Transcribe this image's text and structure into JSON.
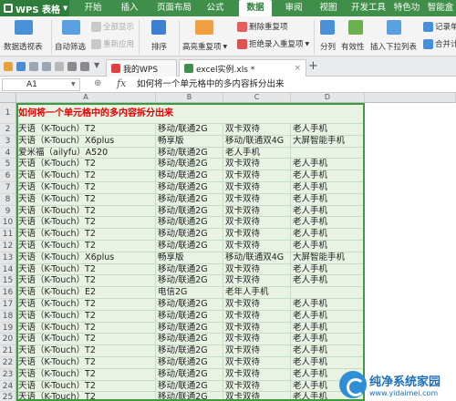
{
  "app": {
    "title": "WPS 表格"
  },
  "menu": {
    "items": [
      {
        "label": "开始",
        "active": false
      },
      {
        "label": "插入",
        "active": false
      },
      {
        "label": "页面布局",
        "active": false
      },
      {
        "label": "公式",
        "active": false
      },
      {
        "label": "数据",
        "active": true
      },
      {
        "label": "审阅",
        "active": false
      },
      {
        "label": "视图",
        "active": false
      },
      {
        "label": "开发工具",
        "active": false
      },
      {
        "label": "特色功能",
        "active": false
      },
      {
        "label": "智能盒子",
        "active": false
      }
    ]
  },
  "ribbon": {
    "pivot_label": "数据透视表",
    "autofilter_label": "自动筛选",
    "show_all_label": "全部显示",
    "reapply_label": "重新应用",
    "sort_label": "排序",
    "highlight_dup_label": "高亮重复项",
    "remove_dup_label": "删除重复项",
    "reject_dup_label": "拒绝录入重复项",
    "split_label": "分列",
    "validity_label": "有效性",
    "dropdown_label": "插入下拉列表",
    "record_label": "记录单",
    "merge_calc_label": "合并计算"
  },
  "tabs": [
    {
      "label": "我的WPS"
    },
    {
      "label": "excel实例.xls *"
    }
  ],
  "formula_bar": {
    "cell_ref": "A1",
    "fx": "fx",
    "content": "如何将一个单元格中的多内容拆分出来"
  },
  "columns": [
    "A",
    "B",
    "C",
    "D"
  ],
  "rows": [
    {
      "n": "1",
      "a": "如何将一个单元格中的多内容拆分出来",
      "b": "",
      "c": "",
      "d": ""
    },
    {
      "n": "2",
      "a": "天语（K-Touch）T2",
      "b": "移动/联通2G",
      "c": "双卡双待",
      "d": "老人手机"
    },
    {
      "n": "3",
      "a": "天语（K-Touch）X6plus",
      "b": "畅享版",
      "c": "移动/联通双4G",
      "d": "大屏智能手机"
    },
    {
      "n": "4",
      "a": "爱米福（ailyfu）A520",
      "b": "移动/联通2G",
      "c": "老人手机",
      "d": ""
    },
    {
      "n": "5",
      "a": "天语（K-Touch）T2",
      "b": "移动/联通2G",
      "c": "双卡双待",
      "d": "老人手机"
    },
    {
      "n": "6",
      "a": "天语（K-Touch）T2",
      "b": "移动/联通2G",
      "c": "双卡双待",
      "d": "老人手机"
    },
    {
      "n": "7",
      "a": "天语（K-Touch）T2",
      "b": "移动/联通2G",
      "c": "双卡双待",
      "d": "老人手机"
    },
    {
      "n": "8",
      "a": "天语（K-Touch）T2",
      "b": "移动/联通2G",
      "c": "双卡双待",
      "d": "老人手机"
    },
    {
      "n": "9",
      "a": "天语（K-Touch）T2",
      "b": "移动/联通2G",
      "c": "双卡双待",
      "d": "老人手机"
    },
    {
      "n": "10",
      "a": "天语（K-Touch）T2",
      "b": "移动/联通2G",
      "c": "双卡双待",
      "d": "老人手机"
    },
    {
      "n": "11",
      "a": "天语（K-Touch）T2",
      "b": "移动/联通2G",
      "c": "双卡双待",
      "d": "老人手机"
    },
    {
      "n": "12",
      "a": "天语（K-Touch）T2",
      "b": "移动/联通2G",
      "c": "双卡双待",
      "d": "老人手机"
    },
    {
      "n": "13",
      "a": "天语（K-Touch）X6plus",
      "b": "畅享版",
      "c": "移动/联通双4G",
      "d": "大屏智能手机"
    },
    {
      "n": "14",
      "a": "天语（K-Touch）T2",
      "b": "移动/联通2G",
      "c": "双卡双待",
      "d": "老人手机"
    },
    {
      "n": "15",
      "a": "天语（K-Touch）T2",
      "b": "移动/联通2G",
      "c": "双卡双待",
      "d": "老人手机"
    },
    {
      "n": "16",
      "a": "天语（K-Touch）E2",
      "b": "电信2G",
      "c": "老年人手机",
      "d": ""
    },
    {
      "n": "17",
      "a": "天语（K-Touch）T2",
      "b": "移动/联通2G",
      "c": "双卡双待",
      "d": "老人手机"
    },
    {
      "n": "18",
      "a": "天语（K-Touch）T2",
      "b": "移动/联通2G",
      "c": "双卡双待",
      "d": "老人手机"
    },
    {
      "n": "19",
      "a": "天语（K-Touch）T2",
      "b": "移动/联通2G",
      "c": "双卡双待",
      "d": "老人手机"
    },
    {
      "n": "20",
      "a": "天语（K-Touch）T2",
      "b": "移动/联通2G",
      "c": "双卡双待",
      "d": "老人手机"
    },
    {
      "n": "21",
      "a": "天语（K-Touch）T2",
      "b": "移动/联通2G",
      "c": "双卡双待",
      "d": "老人手机"
    },
    {
      "n": "22",
      "a": "天语（K-Touch）T2",
      "b": "移动/联通2G",
      "c": "双卡双待",
      "d": "老人手机"
    },
    {
      "n": "23",
      "a": "天语（K-Touch）T2",
      "b": "移动/联通2G",
      "c": "双卡双待",
      "d": "老人手机"
    },
    {
      "n": "24",
      "a": "天语（K-Touch）T2",
      "b": "移动/联通2G",
      "c": "双卡双待",
      "d": "老人手机"
    },
    {
      "n": "25",
      "a": "天语（K-Touch）T2",
      "b": "移动/联通2G",
      "c": "双卡双待",
      "d": "老人手机"
    }
  ],
  "watermark": {
    "title": "纯净系统家园",
    "url": "www.yidaimei.com"
  },
  "colors": {
    "accent": "#3f8f4a",
    "title_text": "#e00000",
    "cell_fill": "#e8f3e4"
  }
}
